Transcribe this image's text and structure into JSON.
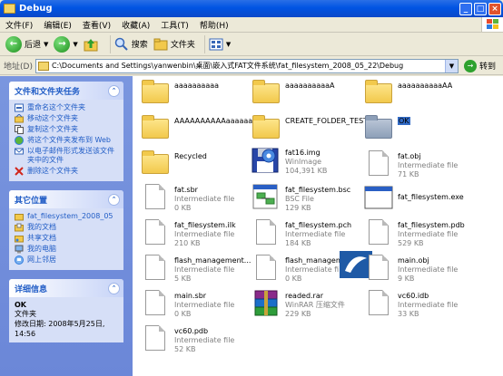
{
  "window": {
    "title": "Debug"
  },
  "menu": [
    "文件(F)",
    "编辑(E)",
    "查看(V)",
    "收藏(A)",
    "工具(T)",
    "帮助(H)"
  ],
  "toolbar": {
    "back": "后退",
    "search": "搜索",
    "folders": "文件夹"
  },
  "address": {
    "label": "地址(D)",
    "path": "C:\\Documents and Settings\\yanwenbin\\桌面\\嵌入式FAT文件系统\\fat_filesystem_2008_05_22\\Debug",
    "go": "转到"
  },
  "tasks": {
    "file_tasks": {
      "title": "文件和文件夹任务",
      "items": [
        "重命名这个文件夹",
        "移动这个文件夹",
        "复制这个文件夹",
        "将这个文件夹发布到 Web",
        "以电子邮件形式发送该文件夹中的文件",
        "删除这个文件夹"
      ]
    },
    "other_places": {
      "title": "其它位置",
      "items": [
        "fat_filesystem_2008_05",
        "我的文档",
        "共享文档",
        "我的电脑",
        "网上邻居"
      ]
    },
    "details": {
      "title": "详细信息",
      "name": "OK",
      "type": "文件夹",
      "modified_label": "修改日期: 2008年5月25日, 14:56"
    }
  },
  "files": [
    {
      "name": "aaaaaaaaaa",
      "line2": "",
      "line3": "",
      "icon": "folder"
    },
    {
      "name": "aaaaaaaaaaA",
      "line2": "",
      "line3": "",
      "icon": "folder"
    },
    {
      "name": "aaaaaaaaaaAA",
      "line2": "",
      "line3": "",
      "icon": "folder"
    },
    {
      "name": "AAAAAAAAAAaaaaaa",
      "line2": "",
      "line3": "",
      "icon": "folder"
    },
    {
      "name": "CREATE_FOLDER_TEST",
      "line2": "",
      "line3": "",
      "icon": "folder"
    },
    {
      "name": "OK",
      "line2": "",
      "line3": "",
      "icon": "folder-selected"
    },
    {
      "name": "Recycled",
      "line2": "",
      "line3": "",
      "icon": "folder"
    },
    {
      "name": "fat16.img",
      "line2": "WinImage",
      "line3": "104,391 KB",
      "icon": "floppy-image"
    },
    {
      "name": "fat.obj",
      "line2": "Intermediate file",
      "line3": "71 KB",
      "icon": "doc"
    },
    {
      "name": "fat.sbr",
      "line2": "Intermediate file",
      "line3": "0 KB",
      "icon": "doc"
    },
    {
      "name": "fat_filesystem.bsc",
      "line2": "BSC File",
      "line3": "129 KB",
      "icon": "bsc"
    },
    {
      "name": "fat_filesystem.exe",
      "line2": "",
      "line3": "",
      "icon": "exe"
    },
    {
      "name": "fat_filesystem.ilk",
      "line2": "Intermediate file",
      "line3": "210 KB",
      "icon": "doc"
    },
    {
      "name": "fat_filesystem.pch",
      "line2": "Intermediate file",
      "line3": "184 KB",
      "icon": "doc"
    },
    {
      "name": "fat_filesystem.pdb",
      "line2": "Intermediate file",
      "line3": "529 KB",
      "icon": "doc"
    },
    {
      "name": "flash_management...",
      "line2": "Intermediate file",
      "line3": "5 KB",
      "icon": "doc"
    },
    {
      "name": "flash_management...",
      "line2": "Intermediate file",
      "line3": "0 KB",
      "icon": "doc-vs"
    },
    {
      "name": "main.obj",
      "line2": "Intermediate file",
      "line3": "9 KB",
      "icon": "doc"
    },
    {
      "name": "main.sbr",
      "line2": "Intermediate file",
      "line3": "0 KB",
      "icon": "doc"
    },
    {
      "name": "readed.rar",
      "line2": "WinRAR 压缩文件",
      "line3": "229 KB",
      "icon": "rar"
    },
    {
      "name": "vc60.idb",
      "line2": "Intermediate file",
      "line3": "33 KB",
      "icon": "doc"
    },
    {
      "name": "vc60.pdb",
      "line2": "Intermediate file",
      "line3": "52 KB",
      "icon": "doc"
    }
  ]
}
